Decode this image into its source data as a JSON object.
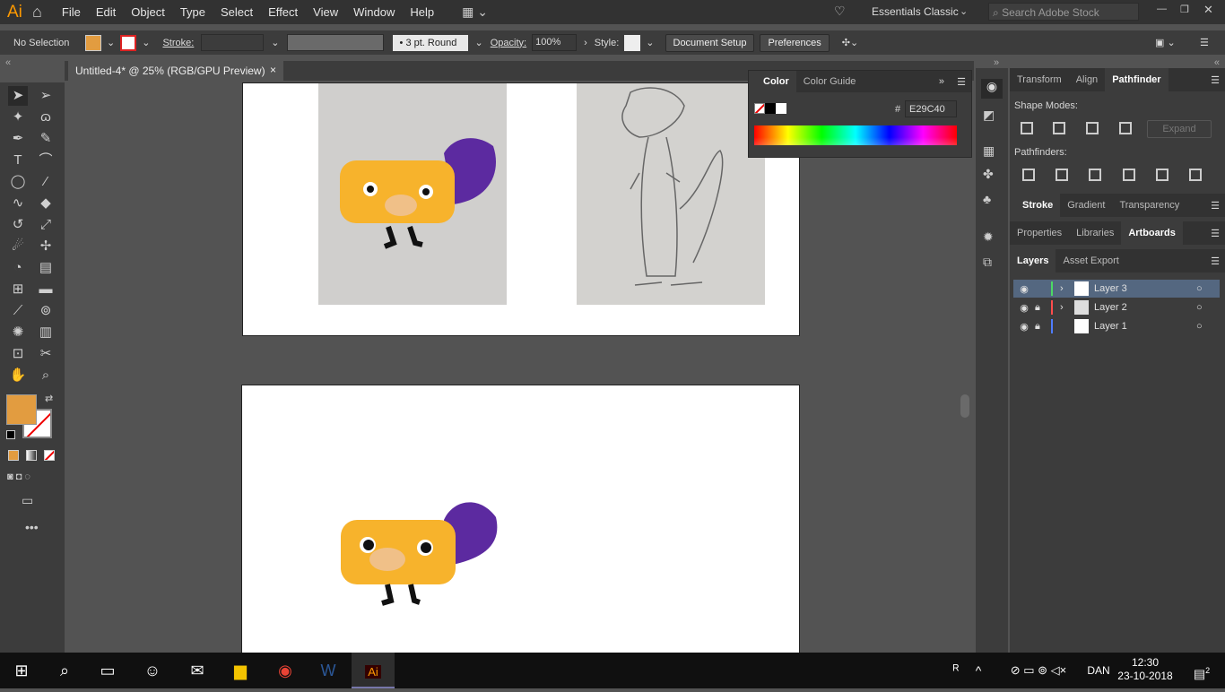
{
  "app": {
    "logo": "Ai",
    "workspace": "Essentials Classic",
    "search_placeholder": "Search Adobe Stock"
  },
  "menu": [
    "File",
    "Edit",
    "Object",
    "Type",
    "Select",
    "Effect",
    "View",
    "Window",
    "Help"
  ],
  "control": {
    "selection": "No Selection",
    "stroke_label": "Stroke:",
    "brush": "3 pt. Round",
    "opacity_label": "Opacity:",
    "opacity": "100%",
    "style_label": "Style:",
    "doc_setup": "Document Setup",
    "preferences": "Preferences"
  },
  "doc_tab": {
    "title": "Untitled-4* @ 25% (RGB/GPU Preview)",
    "close": "×"
  },
  "color_panel": {
    "tabs": [
      "Color",
      "Color Guide"
    ],
    "hex_label": "#",
    "hex": "E29C40"
  },
  "right": {
    "tabs1": [
      "Transform",
      "Align",
      "Pathfinder"
    ],
    "shape_modes": "Shape Modes:",
    "expand": "Expand",
    "pathfinders": "Pathfinders:",
    "tabs2": [
      "Stroke",
      "Gradient",
      "Transparency"
    ],
    "tabs3": [
      "Properties",
      "Libraries",
      "Artboards"
    ],
    "tabs4": [
      "Layers",
      "Asset Export"
    ],
    "layers": [
      {
        "name": "Layer 3",
        "color": "#4cd964",
        "locked": false,
        "selected": true
      },
      {
        "name": "Layer 2",
        "color": "#ff4d4d",
        "locked": true,
        "selected": false
      },
      {
        "name": "Layer 1",
        "color": "#4f7cff",
        "locked": true,
        "selected": false
      }
    ]
  },
  "colors": {
    "fill": "#E29C40",
    "accent": "#ff9a00"
  },
  "taskbar": {
    "lang": "DAN",
    "time": "12:30",
    "date": "23-10-2018",
    "notif": "2"
  }
}
